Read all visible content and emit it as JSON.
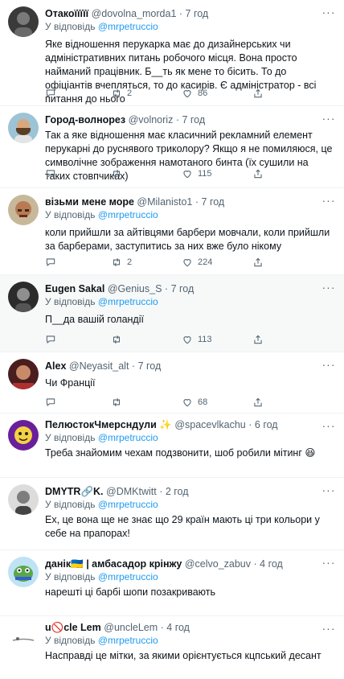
{
  "tweets": [
    {
      "name": "Отакоїїїїї",
      "handle": "@dovolna_morda1",
      "time": "7 год",
      "reply_prefix": "У відповідь",
      "reply_to": "@mrpetruccio",
      "text": "Яке відношення перукарка має до дизайнерських чи адміністративних питань робочого місця. Вона просто найманий працівник. Б__ть як мене то бісить. То до офіціантів вчепляться, то до касирів. Є адміністратор - всі питання до нього",
      "replies": "",
      "retweets": "2",
      "likes": "86"
    },
    {
      "name": "Город-волнорез",
      "handle": "@volnoriz",
      "time": "7 год",
      "reply_prefix": "",
      "reply_to": "",
      "text": "Так а яке відношення має класичний рекламний елемент перукарні до руснявого триколору? Якщо я не помиляюся, це символічне зображення намотаного бинта (їх сушили на таких стовпчиках)",
      "replies": "",
      "retweets": "",
      "likes": "115"
    },
    {
      "name": "візьми мене море",
      "handle": "@Milanisto1",
      "time": "7 год",
      "reply_prefix": "У відповідь",
      "reply_to": "@mrpetruccio",
      "text": "коли прийшли за айтівцями барбери мовчали, коли прийшли за барберами, заступитись за них вже було нікому",
      "replies": "",
      "retweets": "2",
      "likes": "224"
    },
    {
      "name": "Eugen Sakal",
      "handle": "@Genius_S",
      "time": "7 год",
      "reply_prefix": "У відповідь",
      "reply_to": "@mrpetruccio",
      "text": "П__да вашій голандії",
      "replies": "",
      "retweets": "",
      "likes": "113"
    },
    {
      "name": "Alex",
      "handle": "@Neyasit_alt",
      "time": "7 год",
      "reply_prefix": "",
      "reply_to": "",
      "text": "Чи Франції",
      "replies": "",
      "retweets": "",
      "likes": "68"
    },
    {
      "name": "ПелюстокЧмерсндули ✨",
      "handle": "@spacevlkachu",
      "time": "6 год",
      "reply_prefix": "У відповідь",
      "reply_to": "@mrpetruccio",
      "text": "Треба знайомим чехам подзвонити, шоб робили мітинг 😆",
      "replies": "",
      "retweets": "",
      "likes": ""
    },
    {
      "name": "DMYTR🔗K.",
      "handle": "@DMKtwitt",
      "time": "2 год",
      "reply_prefix": "У відповідь",
      "reply_to": "@mrpetruccio",
      "text": "Ех, це вона ще не знає що 29 країн мають ці три кольори у себе на прапорах!",
      "replies": "",
      "retweets": "",
      "likes": ""
    },
    {
      "name": "данік🇺🇦 | амбасадор крінжу",
      "handle": "@celvo_zabuv",
      "time": "4 год",
      "reply_prefix": "У відповідь",
      "reply_to": "@mrpetruccio",
      "text": "нарешті ці барбі шопи позакривають",
      "replies": "",
      "retweets": "",
      "likes": ""
    },
    {
      "name": "u🚫cle Lem",
      "handle": "@uncleLem",
      "time": "4 год",
      "reply_prefix": "У відповідь",
      "reply_to": "@mrpetruccio",
      "text": "Насправді це мітки, за якими орієнтується кцпський десант",
      "replies": "",
      "retweets": "",
      "likes": ""
    }
  ],
  "colors": {
    "accent": "#1d9bf0",
    "secondary_text": "#536471",
    "primary_text": "#0f1419",
    "divider": "#eff3f4"
  },
  "icons": {
    "reply": "speech-bubble-icon",
    "retweet": "retweet-arrows-icon",
    "like": "heart-icon",
    "share": "share-upload-icon",
    "more": "more-dots-icon"
  }
}
